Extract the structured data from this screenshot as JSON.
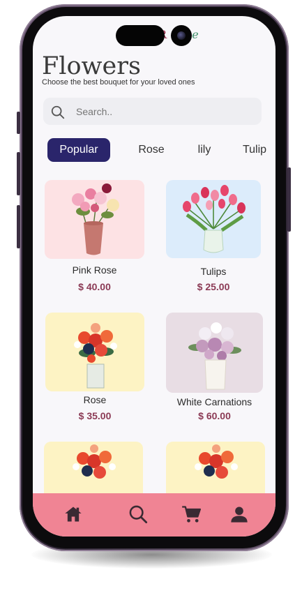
{
  "app": {
    "logo_r": "R",
    "logo_text": "se"
  },
  "header": {
    "title": "Flowers",
    "subtitle": "Choose the best bouquet for your loved ones"
  },
  "search": {
    "placeholder": "Search.."
  },
  "tabs": [
    {
      "label": "Popular",
      "active": true
    },
    {
      "label": "Rose",
      "active": false
    },
    {
      "label": "lily",
      "active": false
    },
    {
      "label": "Tulip",
      "active": false
    }
  ],
  "products": [
    {
      "name": "Pink Rose",
      "price": "$ 40.00",
      "bg": "#fde2e4"
    },
    {
      "name": "Tulips",
      "price": "$ 25.00",
      "bg": "#dcecfb"
    },
    {
      "name": "Rose",
      "price": "$ 35.00",
      "bg": "#fdf3c4"
    },
    {
      "name": "White Carnations",
      "price": "$ 60.00",
      "bg": "#e8dde4"
    },
    {
      "name": "",
      "price": "",
      "bg": "#fdf3c4"
    },
    {
      "name": "",
      "price": "",
      "bg": "#fdf3c4"
    }
  ],
  "nav": {
    "items": [
      "home-icon",
      "search-icon",
      "cart-icon",
      "profile-icon"
    ],
    "bg": "#f08494"
  },
  "colors": {
    "accent": "#2a256b",
    "price": "#8b3a55"
  }
}
